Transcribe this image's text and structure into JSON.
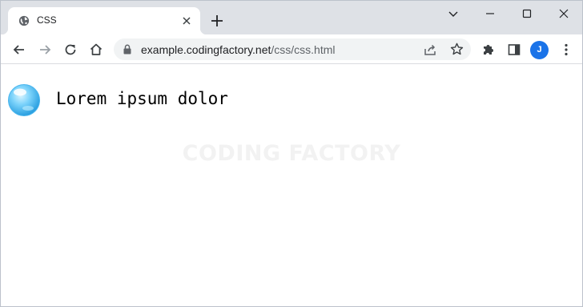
{
  "browser": {
    "tab": {
      "title": "CSS",
      "favicon": "globe-icon"
    },
    "toolbar": {
      "back": "arrow-left-icon",
      "forward": "arrow-right-icon",
      "reload": "reload-icon",
      "home": "home-icon",
      "url_host": "example.codingfactory.net",
      "url_path": "/css/css.html",
      "profile_initial": "J",
      "profile_color": "#1a73e8"
    }
  },
  "page": {
    "icon": "bubble-icon",
    "heading": "Lorem ipsum dolor",
    "watermark": "CODING FACTORY"
  }
}
